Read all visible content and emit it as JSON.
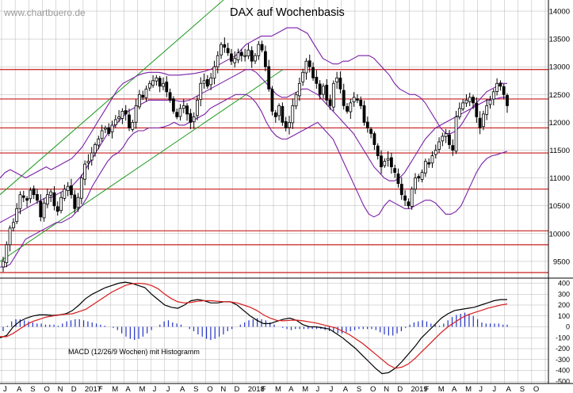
{
  "watermark": "www.chartbuero.de",
  "colors": {
    "background": "#ffffff",
    "grid": "#b4b4b4",
    "candle": "#000000",
    "bollinger": "#7a1fa6",
    "channel": "#1f9a1f",
    "support_lines": "#c81e1e",
    "macd_line": "#000000",
    "signal_line": "#d81b1b",
    "histogram": "#2232c8"
  },
  "chart_data": [
    {
      "type": "candlestick",
      "title": "DAX auf Wochenbasis",
      "ylim": [
        9200,
        14200
      ],
      "y_ticks": [
        9500,
        10000,
        10500,
        11000,
        11500,
        12000,
        12500,
        13000,
        13500,
        14000
      ],
      "x_labels": [
        "J",
        "A",
        "S",
        "O",
        "N",
        "D",
        "2017",
        "F",
        "M",
        "A",
        "M",
        "J",
        "J",
        "A",
        "S",
        "O",
        "N",
        "D",
        "2018",
        "F",
        "M",
        "A",
        "M",
        "J",
        "J",
        "A",
        "S",
        "O",
        "N",
        "D",
        "2019",
        "F",
        "M",
        "A",
        "M",
        "J",
        "J",
        "A",
        "S",
        "O"
      ],
      "horizontal_lines": [
        12950,
        12420,
        11900,
        11450,
        10800,
        10050,
        9800,
        9300
      ],
      "closes": [
        9500,
        9800,
        10100,
        10200,
        10450,
        10700,
        10650,
        10600,
        10780,
        10700,
        10600,
        10300,
        10550,
        10700,
        10750,
        10500,
        10400,
        10650,
        10800,
        10850,
        10700,
        10450,
        10650,
        11000,
        11250,
        11300,
        11450,
        11600,
        11700,
        11850,
        11900,
        11800,
        11950,
        12050,
        12100,
        12200,
        12150,
        11900,
        12000,
        12300,
        12500,
        12450,
        12600,
        12700,
        12750,
        12800,
        12650,
        12700,
        12550,
        12400,
        12200,
        12100,
        12250,
        12300,
        12150,
        12000,
        12100,
        12400,
        12700,
        12750,
        12650,
        12800,
        13000,
        13200,
        13400,
        13350,
        13250,
        13100,
        13150,
        13250,
        13200,
        13200,
        13300,
        13100,
        13200,
        13400,
        13300,
        13000,
        12600,
        12200,
        12100,
        12300,
        12000,
        11900,
        12000,
        12300,
        12500,
        12700,
        12900,
        13100,
        13000,
        12800,
        12700,
        12500,
        12650,
        12400,
        12300,
        12700,
        12800,
        12600,
        12300,
        12200,
        12350,
        12450,
        12400,
        12300,
        12000,
        11900,
        11800,
        11600,
        11400,
        11200,
        11300,
        11350,
        11200,
        11100,
        10900,
        10700,
        10600,
        10500,
        10800,
        11000,
        11000,
        11100,
        11300,
        11250,
        11400,
        11500,
        11650,
        11750,
        11800,
        11600,
        11500,
        12100,
        12250,
        12350,
        12400,
        12450,
        12350,
        12100,
        11900,
        12150,
        12300,
        12400,
        12550,
        12700,
        12650,
        12500,
        12300
      ],
      "bb_upper": [
        11000,
        11100,
        11150,
        11100,
        11050,
        11000,
        11050,
        11100,
        11150,
        11200,
        11150,
        11200,
        11250,
        11300,
        11350,
        11450,
        11550,
        11700,
        11850,
        12000,
        12150,
        12300,
        12450,
        12600,
        12700,
        12750,
        12800,
        12850,
        12880,
        12900,
        12900,
        12900,
        12880,
        12850,
        12850,
        12850,
        12860,
        12870,
        12880,
        12900,
        12920,
        12950,
        13000,
        13050,
        13100,
        13150,
        13200,
        13300,
        13400,
        13450,
        13500,
        13550,
        13550,
        13550,
        13600,
        13650,
        13700,
        13700,
        13700,
        13650,
        13600,
        13450,
        13300,
        13150,
        13100,
        13050,
        13050,
        13100,
        13100,
        13150,
        13200,
        13200,
        13200,
        13150,
        13050,
        12950,
        12850,
        12700,
        12600,
        12550,
        12500,
        12500,
        12450,
        12350,
        12200,
        12050,
        11900,
        11800,
        11800,
        11850,
        11950,
        12100,
        12250,
        12350,
        12450,
        12550,
        12600,
        12650,
        12700,
        12700
      ],
      "bb_mid": [
        10200,
        10250,
        10300,
        10350,
        10400,
        10450,
        10500,
        10550,
        10600,
        10650,
        10650,
        10700,
        10750,
        10800,
        10850,
        10950,
        11050,
        11200,
        11350,
        11500,
        11650,
        11800,
        11900,
        12000,
        12100,
        12200,
        12250,
        12300,
        12350,
        12400,
        12400,
        12400,
        12400,
        12400,
        12400,
        12380,
        12380,
        12400,
        12450,
        12500,
        12550,
        12600,
        12650,
        12700,
        12750,
        12800,
        12850,
        12900,
        12950,
        12950,
        12900,
        12800,
        12700,
        12600,
        12500,
        12450,
        12450,
        12500,
        12550,
        12600,
        12600,
        12550,
        12500,
        12400,
        12300,
        12200,
        12100,
        12000,
        11900,
        11800,
        11650,
        11500,
        11350,
        11200,
        11100,
        11000,
        10950,
        10950,
        11000,
        11100,
        11250,
        11400,
        11550,
        11700,
        11800,
        11900,
        11950,
        12000,
        12050,
        12100,
        12150,
        12200,
        12250,
        12300,
        12350,
        12400,
        12420,
        12430,
        12450,
        12450
      ],
      "bb_lower": [
        9400,
        9400,
        9450,
        9600,
        9750,
        9900,
        9950,
        10000,
        10050,
        10100,
        10150,
        10200,
        10200,
        10250,
        10300,
        10400,
        10500,
        10650,
        10850,
        11000,
        11150,
        11300,
        11400,
        11450,
        11550,
        11700,
        11800,
        11850,
        11850,
        11900,
        11900,
        11900,
        11920,
        11950,
        12000,
        11950,
        11950,
        12000,
        12050,
        12100,
        12150,
        12250,
        12300,
        12350,
        12400,
        12450,
        12500,
        12500,
        12500,
        12450,
        12350,
        12200,
        12000,
        11850,
        11750,
        11700,
        11700,
        11750,
        11800,
        11850,
        11900,
        11950,
        12000,
        11900,
        11800,
        11700,
        11500,
        11300,
        11100,
        10900,
        10700,
        10500,
        10350,
        10300,
        10350,
        10500,
        10600,
        10550,
        10500,
        10450,
        10450,
        10500,
        10550,
        10600,
        10600,
        10550,
        10450,
        10350,
        10350,
        10400,
        10500,
        10700,
        10900,
        11100,
        11250,
        11350,
        11400,
        11420,
        11450,
        11480
      ]
    },
    {
      "type": "line",
      "title": "MACD (12/26/9 Wochen) mit Histogramm",
      "ylim": [
        -520,
        440
      ],
      "y_ticks": [
        400,
        300,
        200,
        100,
        0,
        -100,
        -200,
        -300,
        -400,
        -500
      ],
      "series": [
        {
          "values": [
            -100,
            -80,
            0,
            50,
            80,
            100,
            110,
            110,
            105,
            110,
            120,
            150,
            200,
            260,
            300,
            330,
            360,
            380,
            400,
            410,
            400,
            380,
            360,
            300,
            250,
            200,
            180,
            170,
            200,
            240,
            250,
            240,
            220,
            220,
            230,
            230,
            200,
            150,
            100,
            60,
            30,
            30,
            50,
            70,
            80,
            60,
            20,
            0,
            0,
            -10,
            -20,
            -60,
            -100,
            -150,
            -200,
            -260,
            -320,
            -380,
            -430,
            -420,
            -380,
            -320,
            -250,
            -180,
            -100,
            -40,
            20,
            80,
            120,
            150,
            160,
            170,
            180,
            200,
            220,
            240,
            250,
            250
          ]
        },
        {
          "values": [
            -90,
            -90,
            -60,
            -20,
            20,
            50,
            70,
            90,
            100,
            110,
            115,
            120,
            140,
            160,
            200,
            240,
            280,
            320,
            350,
            380,
            395,
            400,
            395,
            380,
            350,
            300,
            260,
            230,
            220,
            225,
            235,
            240,
            240,
            235,
            230,
            228,
            220,
            200,
            180,
            150,
            110,
            80,
            60,
            55,
            60,
            62,
            55,
            45,
            35,
            20,
            5,
            -10,
            -40,
            -70,
            -110,
            -150,
            -200,
            -250,
            -300,
            -350,
            -380,
            -370,
            -340,
            -290,
            -230,
            -170,
            -110,
            -50,
            0,
            40,
            80,
            110,
            130,
            150,
            170,
            185,
            200,
            210
          ]
        }
      ]
    }
  ],
  "macd_hist": [
    -40,
    10,
    50,
    70,
    70,
    60,
    50,
    40,
    30,
    30,
    20,
    20,
    20,
    10,
    30,
    50,
    60,
    70,
    70,
    60,
    50,
    40,
    30,
    20,
    10,
    0,
    -10,
    -30,
    -60,
    -90,
    -110,
    -120,
    -110,
    -90,
    -60,
    -30,
    0,
    20,
    50,
    60,
    40,
    30,
    20,
    0,
    -20,
    -40,
    -70,
    -90,
    -110,
    -120,
    -110,
    -90,
    -70,
    -40,
    -20,
    0,
    20,
    40,
    60,
    70,
    80,
    70,
    60,
    40,
    20,
    0,
    -10,
    -20,
    -30,
    -20,
    -20,
    -20,
    -20,
    -20,
    -20,
    -20,
    -30,
    -40,
    -50,
    -60,
    -60,
    -50,
    -40,
    -30,
    -20,
    -20,
    -20,
    -20,
    -30,
    -50,
    -70,
    -80,
    -80,
    -60,
    -40,
    -10,
    20,
    40,
    50,
    60,
    50,
    30,
    20,
    10,
    30,
    60,
    90,
    110,
    120,
    130,
    120,
    100,
    70,
    40,
    30,
    30,
    30,
    30,
    20,
    20
  ]
}
